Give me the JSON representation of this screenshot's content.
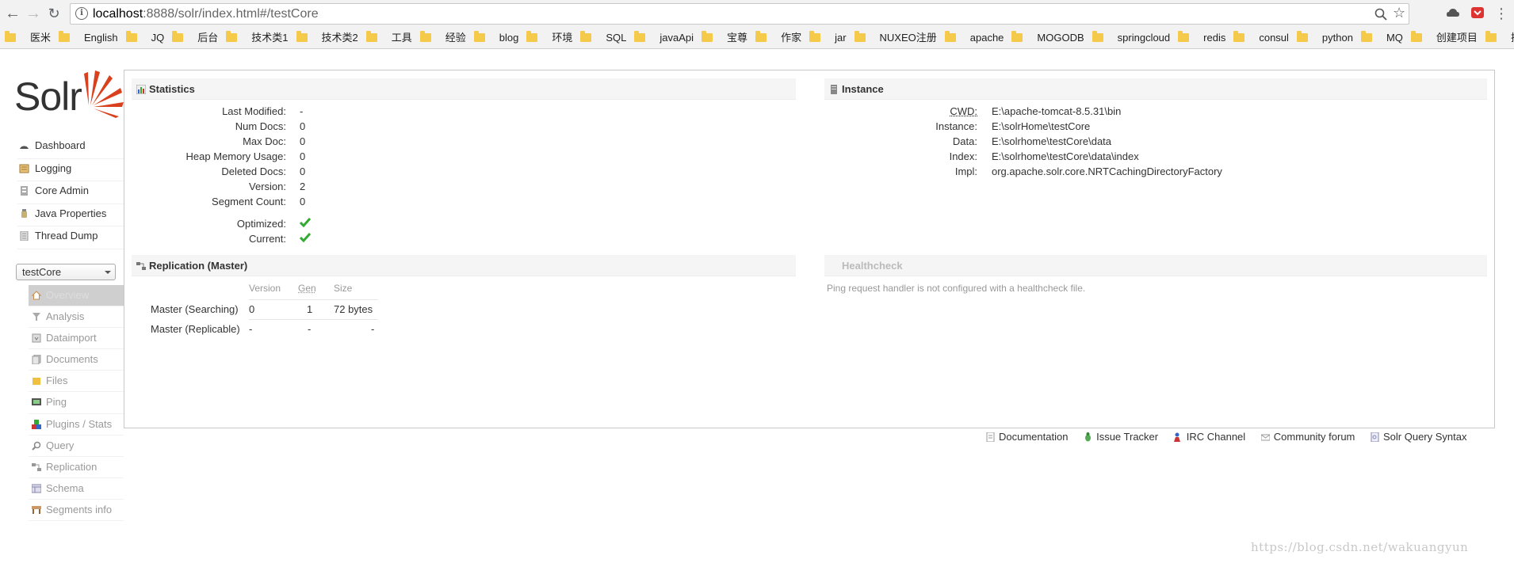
{
  "browser": {
    "url_host": "localhost",
    "url_rest": ":8888/solr/index.html#/testCore",
    "bookmarks": [
      "医米",
      "English",
      "JQ",
      "后台",
      "技术类1",
      "技术类2",
      "工具",
      "经验",
      "blog",
      "环境",
      "SQL",
      "javaApi",
      "宝尊",
      "作家",
      "jar",
      "NUXEO注册",
      "apache",
      "MOGODB",
      "springcloud",
      "redis",
      "consul",
      "python",
      "MQ",
      "创建项目",
      "搜索"
    ]
  },
  "sidebar": {
    "logo_text": "Solr",
    "main_items": [
      "Dashboard",
      "Logging",
      "Core Admin",
      "Java Properties",
      "Thread Dump"
    ],
    "core_selected": "testCore",
    "core_items": [
      "Overview",
      "Analysis",
      "Dataimport",
      "Documents",
      "Files",
      "Ping",
      "Plugins / Stats",
      "Query",
      "Replication",
      "Schema",
      "Segments info"
    ]
  },
  "statistics": {
    "title": "Statistics",
    "rows": [
      {
        "label": "Last Modified:",
        "value": "-"
      },
      {
        "label": "Num Docs:",
        "value": "0"
      },
      {
        "label": "Max Doc:",
        "value": "0"
      },
      {
        "label": "Heap Memory Usage:",
        "value": "0"
      },
      {
        "label": "Deleted Docs:",
        "value": "0"
      },
      {
        "label": "Version:",
        "value": "2"
      },
      {
        "label": "Segment Count:",
        "value": "0"
      }
    ],
    "optimized_label": "Optimized:",
    "current_label": "Current:"
  },
  "instance": {
    "title": "Instance",
    "rows": [
      {
        "label": "CWD:",
        "value": "E:\\apache-tomcat-8.5.31\\bin"
      },
      {
        "label": "Instance:",
        "value": "E:\\solrHome\\testCore"
      },
      {
        "label": "Data:",
        "value": "E:\\solrhome\\testCore\\data"
      },
      {
        "label": "Index:",
        "value": "E:\\solrhome\\testCore\\data\\index"
      },
      {
        "label": "Impl:",
        "value": "org.apache.solr.core.NRTCachingDirectoryFactory"
      }
    ]
  },
  "replication": {
    "title": "Replication (Master)",
    "headers": [
      "Version",
      "Gen",
      "Size"
    ],
    "rows": [
      {
        "label": "Master (Searching)",
        "version": "0",
        "gen": "1",
        "size": "72 bytes"
      },
      {
        "label": "Master (Replicable)",
        "version": "-",
        "gen": "-",
        "size": "-"
      }
    ]
  },
  "healthcheck": {
    "title": "Healthcheck",
    "message": "Ping request handler is not configured with a healthcheck file."
  },
  "footer": [
    "Documentation",
    "Issue Tracker",
    "IRC Channel",
    "Community forum",
    "Solr Query Syntax"
  ],
  "watermark": "https://blog.csdn.net/wakuangyun"
}
